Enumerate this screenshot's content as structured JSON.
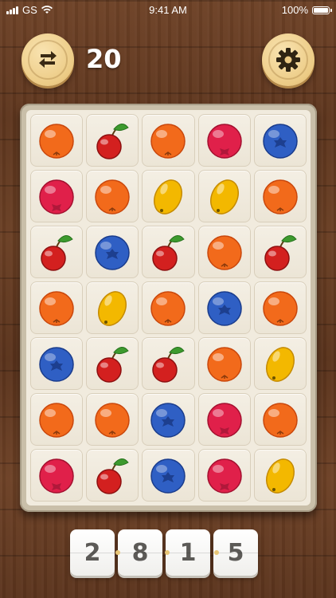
{
  "status_bar": {
    "carrier": "GS",
    "time": "9:41 AM",
    "battery_percent": "100%"
  },
  "header": {
    "swap_icon": "swap-arrows-icon",
    "score": "20",
    "settings_icon": "gear-icon"
  },
  "board": {
    "rows": 7,
    "cols": 5,
    "tiles": [
      [
        "orange",
        "cherry",
        "orange",
        "raspberry",
        "blueberry"
      ],
      [
        "raspberry",
        "orange",
        "lemon",
        "lemon",
        "orange"
      ],
      [
        "cherry",
        "blueberry",
        "cherry",
        "orange",
        "cherry"
      ],
      [
        "orange",
        "lemon",
        "orange",
        "blueberry",
        "orange"
      ],
      [
        "blueberry",
        "cherry",
        "cherry",
        "orange",
        "lemon"
      ],
      [
        "orange",
        "orange",
        "blueberry",
        "raspberry",
        "orange"
      ],
      [
        "raspberry",
        "cherry",
        "blueberry",
        "raspberry",
        "lemon"
      ]
    ]
  },
  "code_digits": [
    "2",
    "8",
    "1",
    "5"
  ],
  "colors": {
    "orange": "#f26a1b",
    "raspberry": "#e0204a",
    "blueberry": "#2f5fc4",
    "lemon": "#f3b800",
    "cherry": "#d3201f",
    "leaf": "#3d9a2e",
    "button": "#eccb85"
  }
}
